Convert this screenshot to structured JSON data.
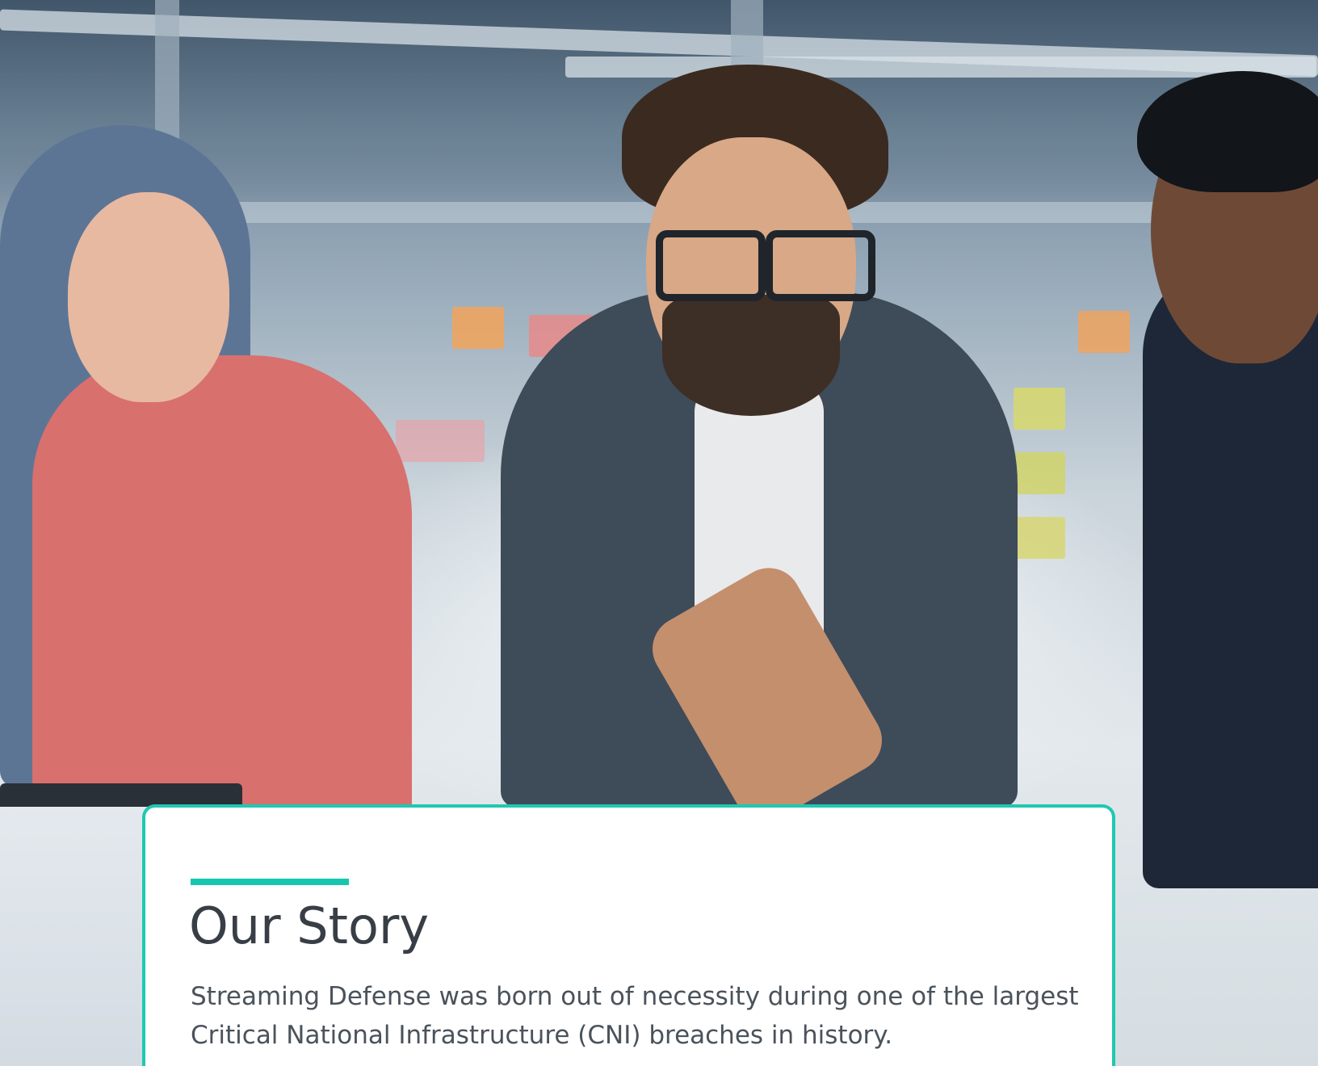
{
  "hero": {
    "scene": "photo",
    "accent_color": "#1fc8b1"
  },
  "story": {
    "title": "Our Story",
    "body_line_1": "Streaming Defense was born out of necessity during one of the largest Critical",
    "body_line_2": "National Infrastructure (CNI) breaches in history."
  }
}
